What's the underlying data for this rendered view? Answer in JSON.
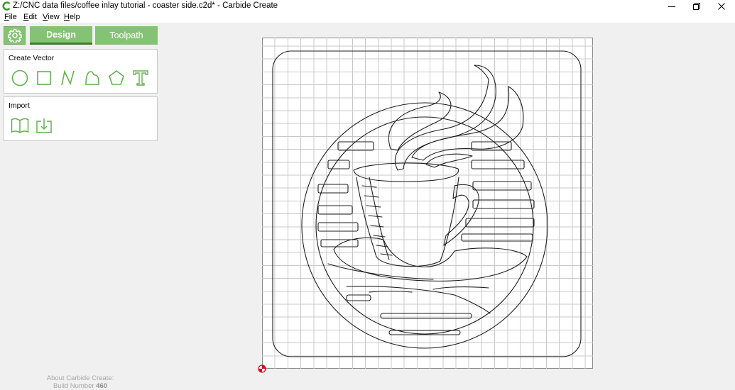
{
  "window": {
    "title": "Z:/CNC data files/coffee inlay tutorial - coaster side.c2d* - Carbide Create",
    "controls": {
      "minimize": "minimize-icon",
      "restore": "restore-icon",
      "close": "close-icon"
    }
  },
  "menu": {
    "file": {
      "mnemonic": "F",
      "rest": "ile"
    },
    "edit": {
      "mnemonic": "E",
      "rest": "dit"
    },
    "view": {
      "mnemonic": "V",
      "rest": "iew"
    },
    "help": {
      "mnemonic": "H",
      "rest": "elp"
    }
  },
  "tabs": {
    "design": "Design",
    "toolpath": "Toolpath",
    "active": "design"
  },
  "create_vector": {
    "title": "Create Vector",
    "tools": [
      "circle-tool-icon",
      "rectangle-tool-icon",
      "polyline-tool-icon",
      "curve-tool-icon",
      "polygon-tool-icon",
      "text-tool-icon"
    ]
  },
  "import": {
    "title": "Import",
    "tools": [
      "open-library-icon",
      "import-file-icon"
    ]
  },
  "footer": {
    "about": "About Carbide Create:",
    "build_prefix": "Build Number",
    "build_number": "460"
  },
  "colors": {
    "accent_green": "#84c373",
    "accent_green_dark": "#3d7e2c",
    "icon_green": "#62b04e",
    "grid": "#c8c8c8",
    "vector": "#1e1e1e",
    "origin_red": "#e0001a"
  }
}
